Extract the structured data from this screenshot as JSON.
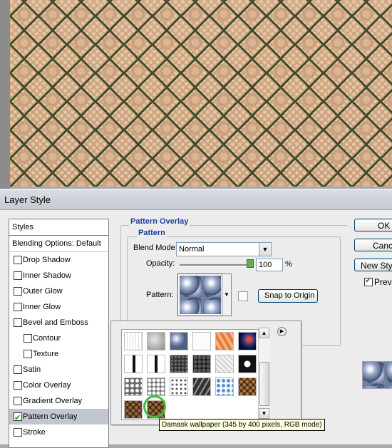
{
  "dialog": {
    "title": "Layer Style"
  },
  "styles_panel": {
    "header": "Styles",
    "blending_options": "Blending Options: Default",
    "items": [
      {
        "label": "Drop Shadow",
        "checked": false,
        "indent": 0
      },
      {
        "label": "Inner Shadow",
        "checked": false,
        "indent": 0
      },
      {
        "label": "Outer Glow",
        "checked": false,
        "indent": 0
      },
      {
        "label": "Inner Glow",
        "checked": false,
        "indent": 0
      },
      {
        "label": "Bevel and Emboss",
        "checked": false,
        "indent": 0
      },
      {
        "label": "Contour",
        "checked": false,
        "indent": 1
      },
      {
        "label": "Texture",
        "checked": false,
        "indent": 1
      },
      {
        "label": "Satin",
        "checked": false,
        "indent": 0
      },
      {
        "label": "Color Overlay",
        "checked": false,
        "indent": 0
      },
      {
        "label": "Gradient Overlay",
        "checked": false,
        "indent": 0
      },
      {
        "label": "Pattern Overlay",
        "checked": true,
        "indent": 0,
        "selected": true
      },
      {
        "label": "Stroke",
        "checked": false,
        "indent": 0
      }
    ]
  },
  "pattern_overlay": {
    "section_title": "Pattern Overlay",
    "group_title": "Pattern",
    "blend_mode_label": "Blend Mode:",
    "blend_mode_value": "Normal",
    "opacity_label": "Opacity:",
    "opacity_value": "100",
    "opacity_unit": "%",
    "opacity_fraction": 1.0,
    "pattern_label": "Pattern:",
    "snap_button": "Snap to Origin"
  },
  "buttons": {
    "ok": "OK",
    "cancel": "Cance",
    "new_style": "New Sty",
    "preview_label": "Prev",
    "preview_checked": true
  },
  "picker": {
    "tooltip": "Damask wallpaper (345 by 400 pixels, RGB mode)",
    "menu_glyph": "▶",
    "scroll_up": "▲",
    "scroll_down": "▼",
    "dropdown_glyph": "▼",
    "thumbnails": [
      "sketch-dots",
      "gray-texture",
      "blue-bubbles",
      "white-blank",
      "orange-tile",
      "dark-blue-space",
      "black-line",
      "black-line-2",
      "dark-granite",
      "dark-mosaic",
      "white-stripes",
      "black-shapes",
      "gray-lace",
      "gray-lace-2",
      "lace-white",
      "black-diagonal",
      "blue-circles",
      "damask-small",
      "damask-wallpaper",
      "damask-wallpaper-selected"
    ]
  },
  "colors": {
    "title_blue": "#1d3f99",
    "selection": "#c1c6cf",
    "highlight_ring": "#3fbf3f",
    "tooltip_bg": "#ffffe1"
  }
}
